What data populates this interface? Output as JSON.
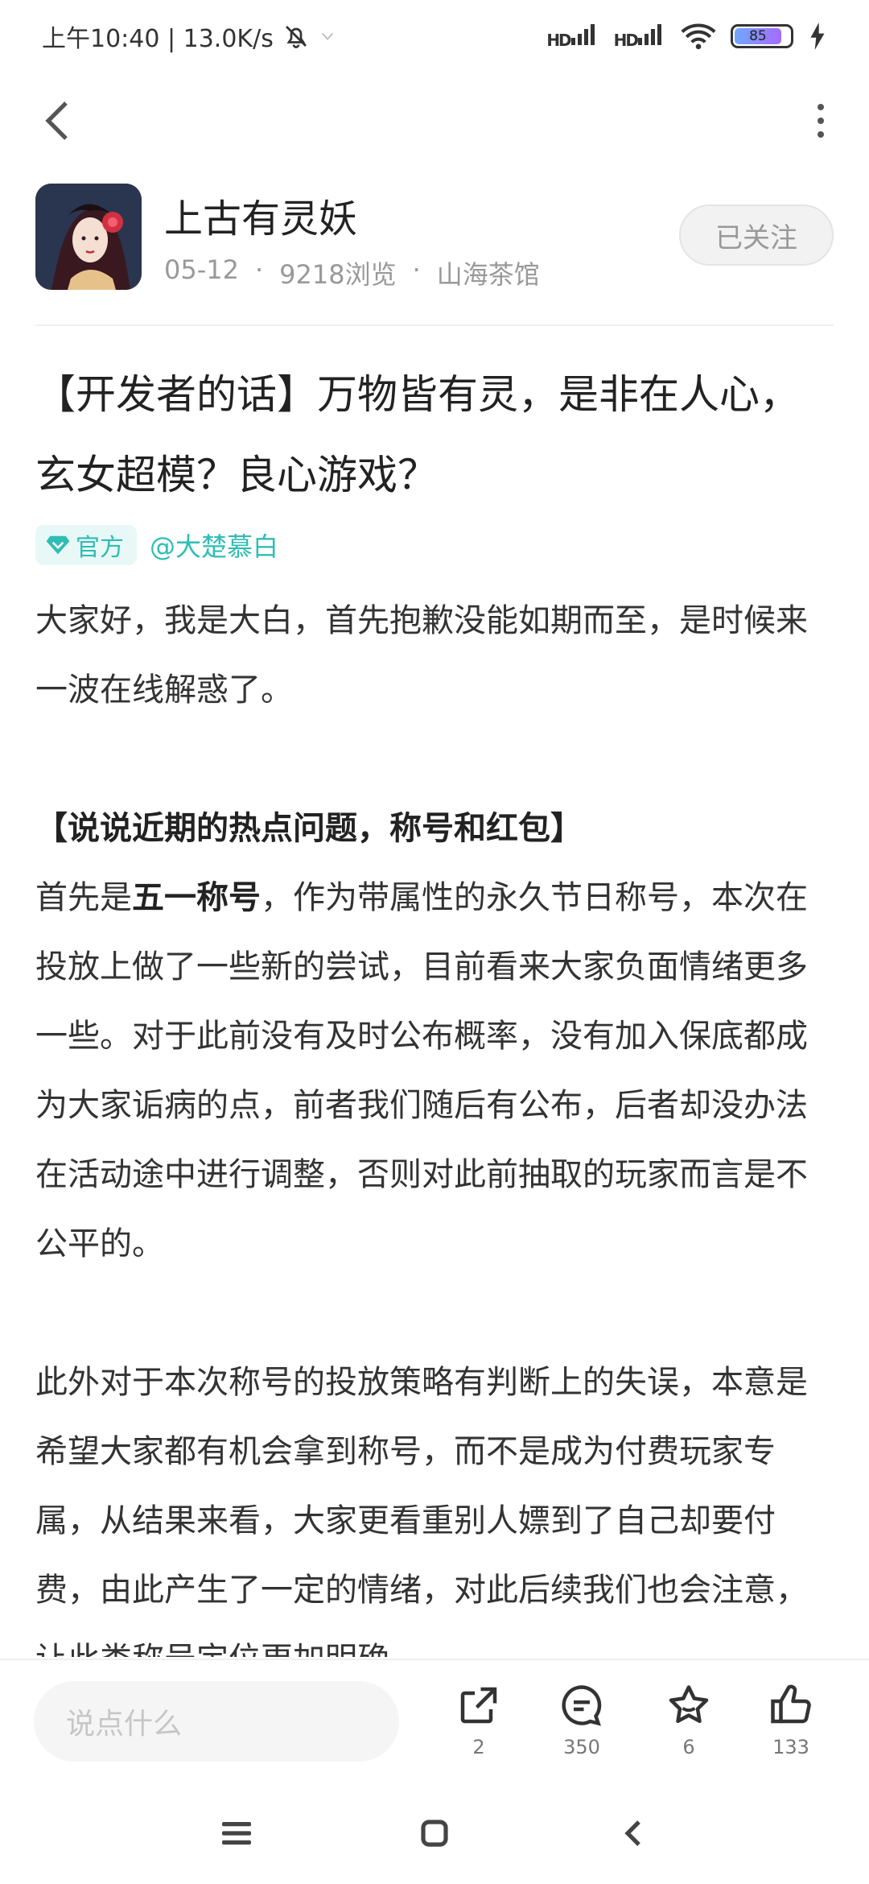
{
  "status_bar": {
    "time_speed": "上午10:40 | 13.0K/s",
    "network1": "HD",
    "network2": "HD",
    "battery": "85"
  },
  "author": {
    "name": "上古有灵妖",
    "date": "05-12",
    "views": "9218浏览",
    "forum": "山海茶馆",
    "follow_label": "已关注"
  },
  "post": {
    "title": "【开发者的话】万物皆有灵，是非在人心，玄女超模？良心游戏？",
    "official_tag": "官方",
    "mention": "@大楚慕白",
    "p1": "大家好，我是大白，首先抱歉没能如期而至，是时候来一波在线解惑了。",
    "heading": "【说说近期的热点问题，称号和红包】",
    "p2_pre": "首先是",
    "p2_bold": "五一称号",
    "p2_post": "，作为带属性的永久节日称号，本次在投放上做了一些新的尝试，目前看来大家负面情绪更多一些。对于此前没有及时公布概率，没有加入保底都成为大家诟病的点，前者我们随后有公布，后者却没办法在活动途中进行调整，否则对此前抽取的玩家而言是不公平的。",
    "p3": "此外对于本次称号的投放策略有判断上的失误，本意是希望大家都有机会拿到称号，而不是成为付费玩家专属，从结果来看，大家更看重别人嫖到了自己却要付费，由此产生了一定的情绪，对此后续我们也会注意，让此类称号定位更加明确。"
  },
  "actions": {
    "comment_placeholder": "说点什么",
    "share_count": "2",
    "comment_count": "350",
    "favorite_count": "6",
    "like_count": "133"
  },
  "colors": {
    "accent": "#2ebdb4",
    "meta_gray": "#999999"
  }
}
